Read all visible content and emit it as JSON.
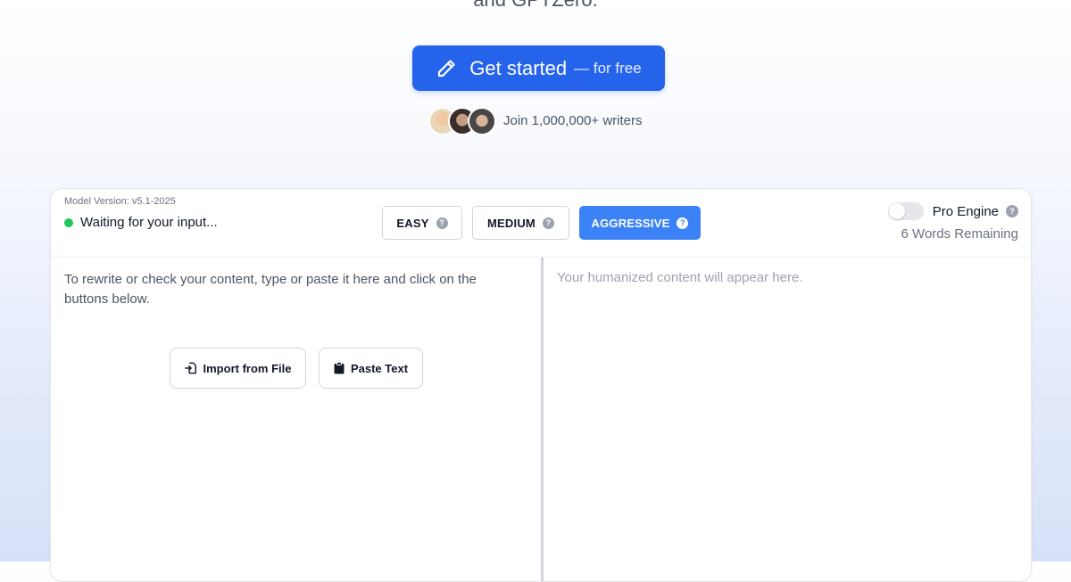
{
  "hero": {
    "tail_text": "and GPTZero.",
    "cta_label": "Get started",
    "cta_suffix": "— for free",
    "cta_icon": "pencil-icon",
    "social_proof": "Join 1,000,000+ writers"
  },
  "editor": {
    "model_version": "Model Version: v5.1-2025",
    "status_text": "Waiting for your input...",
    "status_color": "#22c55e",
    "modes": [
      {
        "label": "EASY",
        "selected": false
      },
      {
        "label": "MEDIUM",
        "selected": false
      },
      {
        "label": "AGGRESSIVE",
        "selected": true
      }
    ],
    "pro_engine_label": "Pro Engine",
    "pro_engine_enabled": false,
    "words_remaining": "6 Words Remaining",
    "input_hint": "To rewrite or check your content, type or paste it here and click on the buttons below.",
    "import_button": "Import from File",
    "paste_button": "Paste Text",
    "output_placeholder": "Your humanized content will appear here."
  },
  "colors": {
    "primary": "#2563eb",
    "accent": "#3b82f6"
  }
}
